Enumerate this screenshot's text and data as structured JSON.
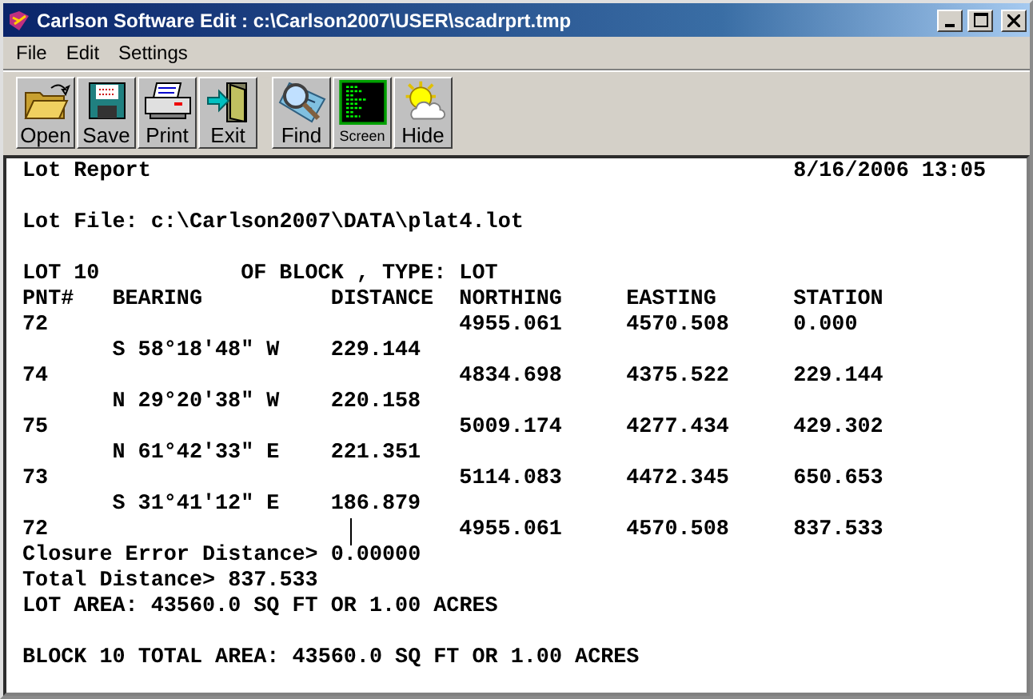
{
  "window": {
    "title": "Carlson Software Edit : c:\\Carlson2007\\USER\\scadrprt.tmp"
  },
  "menu": [
    "File",
    "Edit",
    "Settings"
  ],
  "toolbar_groups": [
    [
      {
        "kind": "open",
        "label": "Open"
      },
      {
        "kind": "save",
        "label": "Save"
      },
      {
        "kind": "print",
        "label": "Print"
      },
      {
        "kind": "exit",
        "label": "Exit"
      }
    ],
    [
      {
        "kind": "find",
        "label": "Find"
      },
      {
        "kind": "screen",
        "label": "Screen"
      },
      {
        "kind": "hide",
        "label": "Hide"
      }
    ]
  ],
  "report": {
    "title": "Lot Report",
    "date": "8/16/2006 13:05",
    "lot_file": "Lot File: c:\\Carlson2007\\DATA\\plat4.lot",
    "lot_line": [
      "LOT 10",
      "OF BLOCK , TYPE:",
      "LOT"
    ],
    "columns": [
      "PNT#",
      "BEARING",
      "DISTANCE",
      "NORTHING",
      "EASTING",
      "STATION"
    ],
    "rows": [
      {
        "kind": "point",
        "pnt": "72",
        "northing": "4955.061",
        "easting": "4570.508",
        "station": "0.000"
      },
      {
        "kind": "leg",
        "bearing": "S 58°18'48\" W",
        "distance": "229.144"
      },
      {
        "kind": "point",
        "pnt": "74",
        "northing": "4834.698",
        "easting": "4375.522",
        "station": "229.144"
      },
      {
        "kind": "leg",
        "bearing": "N 29°20'38\" W",
        "distance": "220.158"
      },
      {
        "kind": "point",
        "pnt": "75",
        "northing": "5009.174",
        "easting": "4277.434",
        "station": "429.302"
      },
      {
        "kind": "leg",
        "bearing": "N 61°42'33\" E",
        "distance": "221.351"
      },
      {
        "kind": "point",
        "pnt": "73",
        "northing": "5114.083",
        "easting": "4472.345",
        "station": "650.653"
      },
      {
        "kind": "leg",
        "bearing": "S 31°41'12\" E",
        "distance": "186.879"
      },
      {
        "kind": "point",
        "pnt": "72",
        "northing": "4955.061",
        "easting": "4570.508",
        "station": "837.533",
        "cursor": true
      }
    ],
    "summary": [
      "Closure Error Distance> 0.00000",
      "Total Distance> 837.533",
      "LOT AREA: 43560.0 SQ FT OR 1.00 ACRES"
    ],
    "block_total": "BLOCK 10 TOTAL AREA: 43560.0 SQ FT OR 1.00 ACRES"
  }
}
